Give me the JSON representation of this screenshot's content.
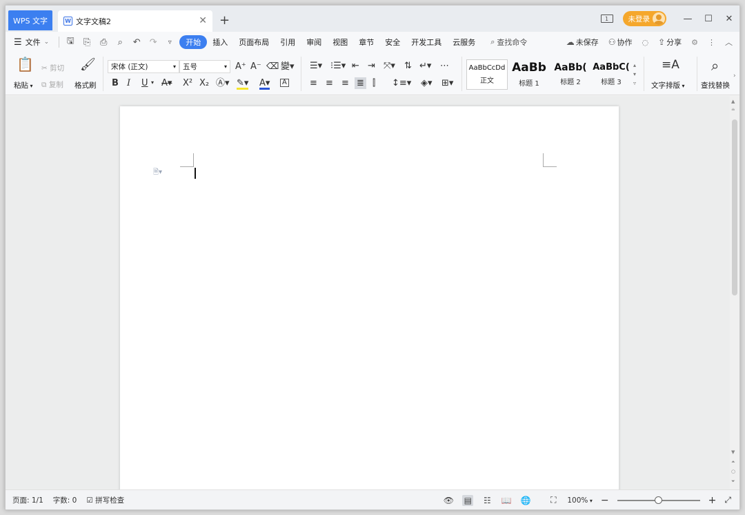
{
  "titlebar": {
    "app_tab": "WPS 文字",
    "doc_tab": "文字文稿2",
    "doc_icon": "W",
    "new_tab": "+",
    "login": "未登录"
  },
  "menubar": {
    "file": "文件",
    "tabs": [
      "开始",
      "插入",
      "页面布局",
      "引用",
      "审阅",
      "视图",
      "章节",
      "安全",
      "开发工具",
      "云服务"
    ],
    "search": "查找命令",
    "unsaved": "未保存",
    "collab": "协作",
    "share": "分享"
  },
  "ribbon": {
    "paste": "粘贴",
    "cut": "剪切",
    "copy": "复制",
    "format_painter": "格式刷",
    "font_name": "宋体 (正文)",
    "font_size": "五号",
    "bold": "B",
    "italic": "I",
    "underline": "U",
    "superscript": "X²",
    "subscript": "X₂",
    "styles": [
      {
        "sample": "AaBbCcDd",
        "name": "正文"
      },
      {
        "sample": "AaBb",
        "name": "标题 1"
      },
      {
        "sample": "AaBb(",
        "name": "标题 2"
      },
      {
        "sample": "AaBbC(",
        "name": "标题 3"
      }
    ],
    "text_layout": "文字排版",
    "find_replace": "查找替换"
  },
  "status": {
    "page": "页面: 1/1",
    "words": "字数: 0",
    "spell": "拼写检查",
    "zoom": "100%",
    "zoom_level": 0.5
  },
  "colors": {
    "accent": "#3c7ff0",
    "login_bg": "#f5a72c"
  }
}
